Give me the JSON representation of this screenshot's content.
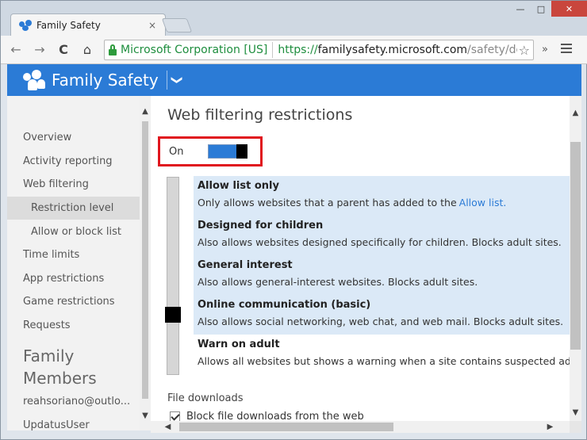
{
  "browser": {
    "tab_title": "Family Safety",
    "tab_close": "×",
    "window_controls": {
      "minimize": "—",
      "maximize": "□",
      "close": "✕"
    },
    "nav": {
      "back": "←",
      "forward": "→",
      "reload": "C",
      "home": "⌂"
    },
    "ev_cert": "Microsoft Corporation [US]",
    "url_scheme": "https://",
    "url_host": "familysafety.microsoft.com",
    "url_path": "/safety/def",
    "bookmark_icon": "☆",
    "extensions_overflow": "»"
  },
  "app": {
    "title": "Family Safety",
    "menu_chevron": "❯"
  },
  "sidebar": {
    "items": [
      {
        "label": "Overview"
      },
      {
        "label": "Activity reporting"
      },
      {
        "label": "Web filtering"
      },
      {
        "label": "Restriction level"
      },
      {
        "label": "Allow or block list"
      },
      {
        "label": "Time limits"
      },
      {
        "label": "App restrictions"
      },
      {
        "label": "Game restrictions"
      },
      {
        "label": "Requests"
      }
    ],
    "family_heading_1": "Family",
    "family_heading_2": "Members",
    "members": [
      {
        "label": "reahsoriano@outlo..."
      },
      {
        "label": "UpdatusUser"
      }
    ]
  },
  "main": {
    "page_title": "Web filtering restrictions",
    "toggle_label": "On",
    "toggle_state": "on",
    "levels": [
      {
        "title": "Allow list only",
        "desc": "Only allows websites that a parent has added to the",
        "link": "Allow list."
      },
      {
        "title": "Designed for children",
        "desc": "Also allows websites designed specifically for children. Blocks adult sites."
      },
      {
        "title": "General interest",
        "desc": "Also allows general-interest websites. Blocks adult sites."
      },
      {
        "title": "Online communication (basic)",
        "desc": "Also allows social networking, web chat, and web mail. Blocks adult sites."
      },
      {
        "title": "Warn on adult",
        "desc": "Allows all websites but shows a warning when a site contains suspected adult"
      }
    ],
    "selected_level": "Online communication (basic)",
    "file_downloads_heading": "File downloads",
    "block_downloads_label": "Block file downloads from the web",
    "block_downloads_checked": true
  },
  "colors": {
    "accent": "#2b7bd6",
    "highlight_border": "#e0161e",
    "selected_band": "#dbe9f7"
  }
}
